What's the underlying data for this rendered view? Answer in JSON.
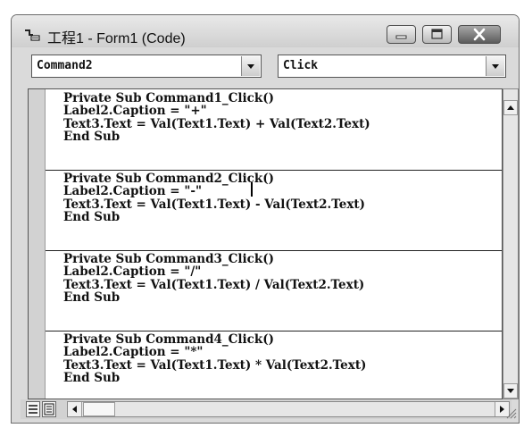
{
  "window": {
    "title": "工程1 - Form1 (Code)"
  },
  "object_combo": {
    "value": "Command2",
    "icon": "chevron-down-icon"
  },
  "procedure_combo": {
    "value": "Click",
    "icon": "chevron-down-icon"
  },
  "code": {
    "procedures": [
      {
        "lines": [
          "Private Sub Command1_Click()",
          "Label2.Caption = \"+\"",
          "Text3.Text = Val(Text1.Text) + Val(Text2.Text)",
          "End Sub"
        ]
      },
      {
        "lines": [
          "Private Sub Command2_Click()",
          "Label2.Caption = \"-\"",
          "Text3.Text = Val(Text1.Text) - Val(Text2.Text)",
          "End Sub"
        ]
      },
      {
        "lines": [
          "Private Sub Command3_Click()",
          "Label2.Caption = \"/\"",
          "Text3.Text = Val(Text1.Text) / Val(Text2.Text)",
          "End Sub"
        ]
      },
      {
        "lines": [
          "Private Sub Command4_Click()",
          "Label2.Caption = \"*\"",
          "Text3.Text = Val(Text1.Text) * Val(Text2.Text)",
          "End Sub"
        ]
      }
    ]
  },
  "icons": {
    "app": "vb-code-window-icon",
    "minimize": "minimize-icon",
    "maximize": "maximize-icon",
    "close": "close-icon",
    "procedure_view": "procedure-view-icon",
    "full_module_view": "full-module-view-icon"
  },
  "colors": {
    "chrome": "#dadada",
    "close_button": "#5c5c5c",
    "editor_bg": "#ffffff"
  }
}
